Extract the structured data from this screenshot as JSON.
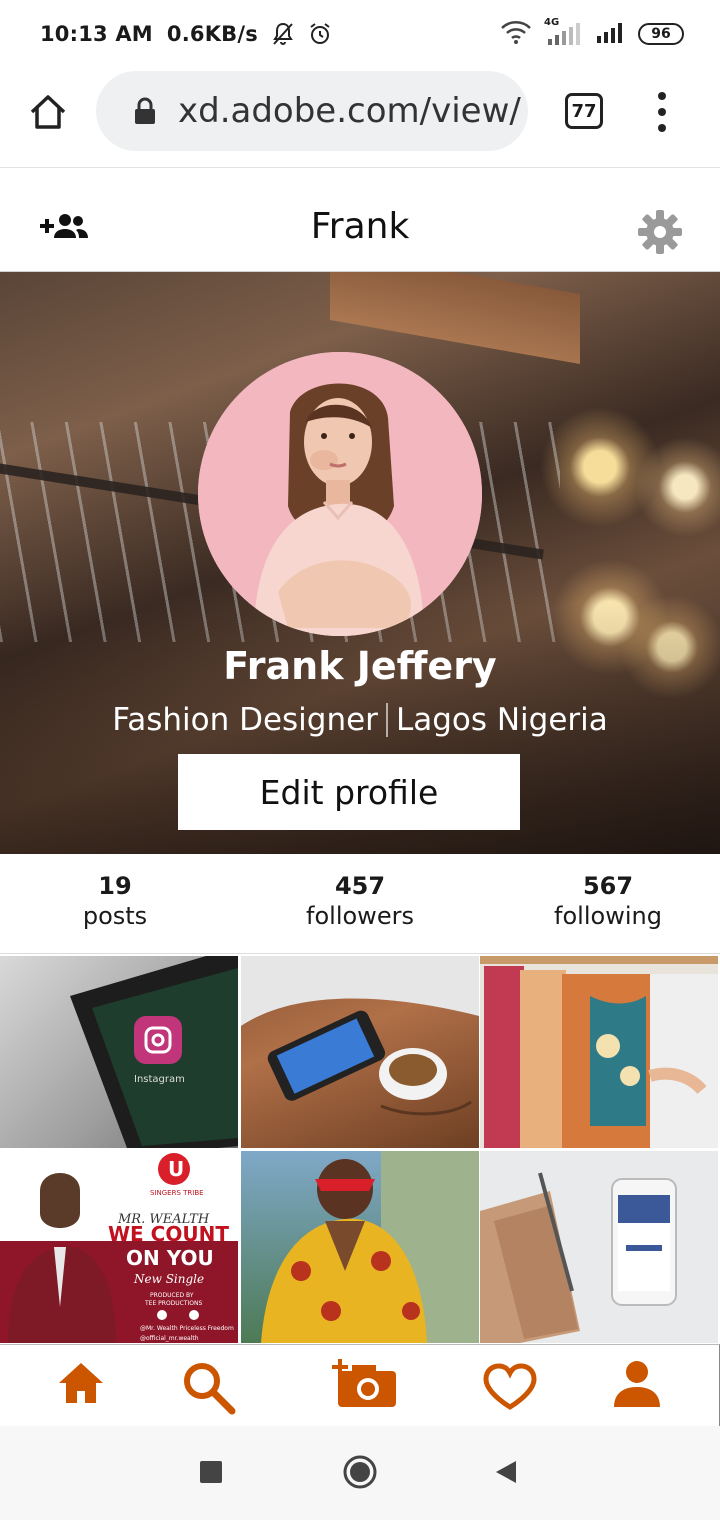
{
  "status_bar": {
    "time": "10:13 AM",
    "speed": "0.6KB/s",
    "network": "4G",
    "battery": "96"
  },
  "browser": {
    "url": "xd.adobe.com/view/",
    "tab_count": "77"
  },
  "header": {
    "title": "Frank"
  },
  "profile": {
    "name": "Frank Jeffery",
    "role": "Fashion Designer",
    "location": "Lagos Nigeria",
    "edit_label": "Edit profile"
  },
  "stats": [
    {
      "value": "19",
      "label": "posts"
    },
    {
      "value": "457",
      "label": "followers"
    },
    {
      "value": "567",
      "label": "following"
    }
  ],
  "posts": {
    "poster": {
      "brand": "SINGERS TRIBE",
      "artist": "MR. WEALTH",
      "title_line1": "WE COUNT",
      "title_line2": "ON YOU",
      "subtitle": "New Single",
      "produced": "PRODUCED BY",
      "producer": "TEE PRODUCTIONS",
      "fb_handle": "@Mr. Wealth Priceless Freedom",
      "ig_handle": "@official_mr.wealth"
    },
    "app_label": "Instagram"
  },
  "colors": {
    "accent": "#CC5500",
    "avatar_bg": "#F3B7BF"
  },
  "icons": {
    "nav": [
      "home-icon",
      "search-icon",
      "add-photo-icon",
      "heart-icon",
      "profile-icon"
    ]
  }
}
